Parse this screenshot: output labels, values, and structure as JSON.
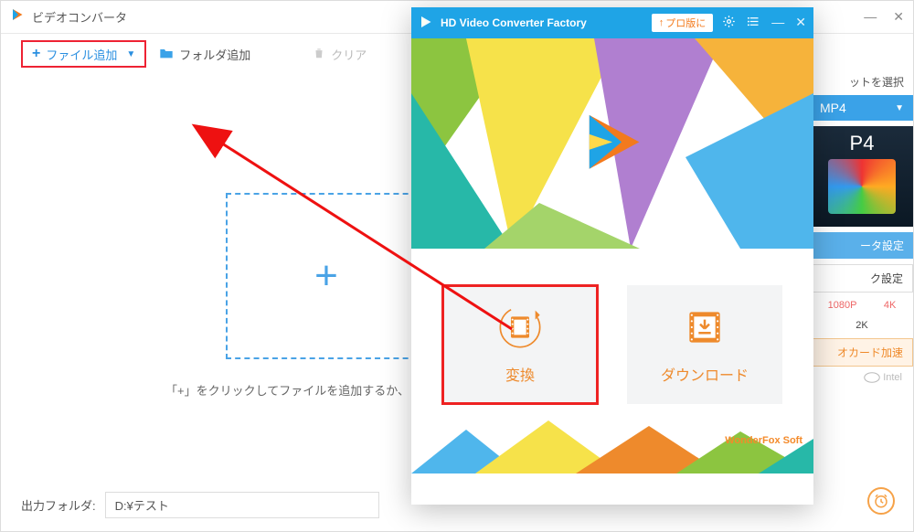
{
  "back": {
    "title": "ビデオコンバータ",
    "toolbar": {
      "add_file": "ファイル追加",
      "add_folder": "フォルダ追加",
      "clear": "クリア"
    },
    "drop_hint": "「+」をクリックしてファイルを追加するか、ま",
    "output_label": "出力フォルダ:",
    "output_value": "D:¥テスト"
  },
  "side": {
    "select_label": "ットを選択",
    "format": "MP4",
    "thumb_label": "P4",
    "param_btn": "ータ設定",
    "quick_btn": "ク設定",
    "res_1080": "1080P",
    "res_4k": "4K",
    "res_2k": "2K",
    "accel": "オカード加速",
    "intel": "Intel"
  },
  "front": {
    "title": "HD Video Converter Factory",
    "pro_badge": "プロ版に",
    "tiles": {
      "convert": "変換",
      "download": "ダウンロード"
    },
    "footer_brand": "WonderFox Soft"
  },
  "icons": {
    "logo": "app-logo-icon",
    "folder": "folder-icon",
    "trash": "trash-icon",
    "gear": "gear-icon",
    "list": "list-icon",
    "minimize": "minimize-icon",
    "close": "close-icon",
    "clock": "clock-icon",
    "chevron_down": "chevron-down-icon",
    "arrow_up": "arrow-up-icon"
  }
}
